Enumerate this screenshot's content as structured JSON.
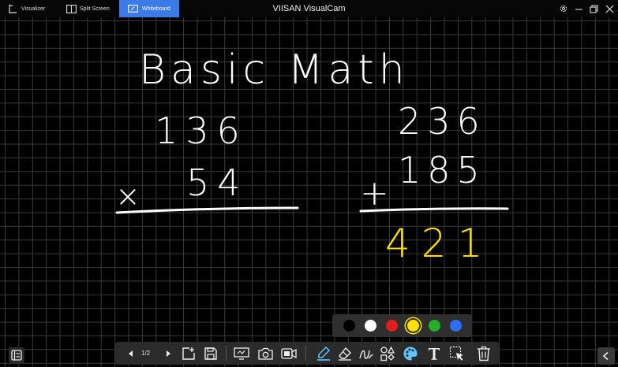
{
  "titlebar": {
    "app_title": "VIISAN VisualCam",
    "tabs": [
      {
        "label": "Visualizer",
        "icon": "visualizer-icon"
      },
      {
        "label": "Split Screen",
        "icon": "split-screen-icon"
      },
      {
        "label": "Whiteboard",
        "icon": "whiteboard-icon",
        "active": true
      }
    ],
    "controls": [
      "settings-icon",
      "minimize-icon",
      "restore-icon",
      "close-icon"
    ]
  },
  "whiteboard": {
    "heading": "Basic Math",
    "problem_1": {
      "top": "136",
      "operator": "×",
      "bottom": "54",
      "answer": ""
    },
    "problem_2": {
      "top": "236",
      "operator": "+",
      "bottom": "185",
      "answer": "421"
    },
    "ink_color": "#ffffff",
    "answer_color": "#ffe100",
    "grid_color": "#3a3a3a"
  },
  "palette": {
    "colors": [
      "#000000",
      "#ffffff",
      "#e51c1c",
      "#ffe100",
      "#22b02a",
      "#2d6ef2"
    ],
    "selected": "#ffe100"
  },
  "toolbar": {
    "page_indicator": "1/2",
    "tools": [
      "prev-page-icon",
      "next-page-icon",
      "add-page-icon",
      "save-icon",
      "screen-capture-icon",
      "camera-icon",
      "video-record-icon",
      "highlighter-icon",
      "eraser-icon",
      "pen-stroke-icon",
      "shapes-icon",
      "color-palette-icon",
      "text-tool-icon",
      "select-icon",
      "delete-icon"
    ],
    "accent": "#3b7be8"
  }
}
